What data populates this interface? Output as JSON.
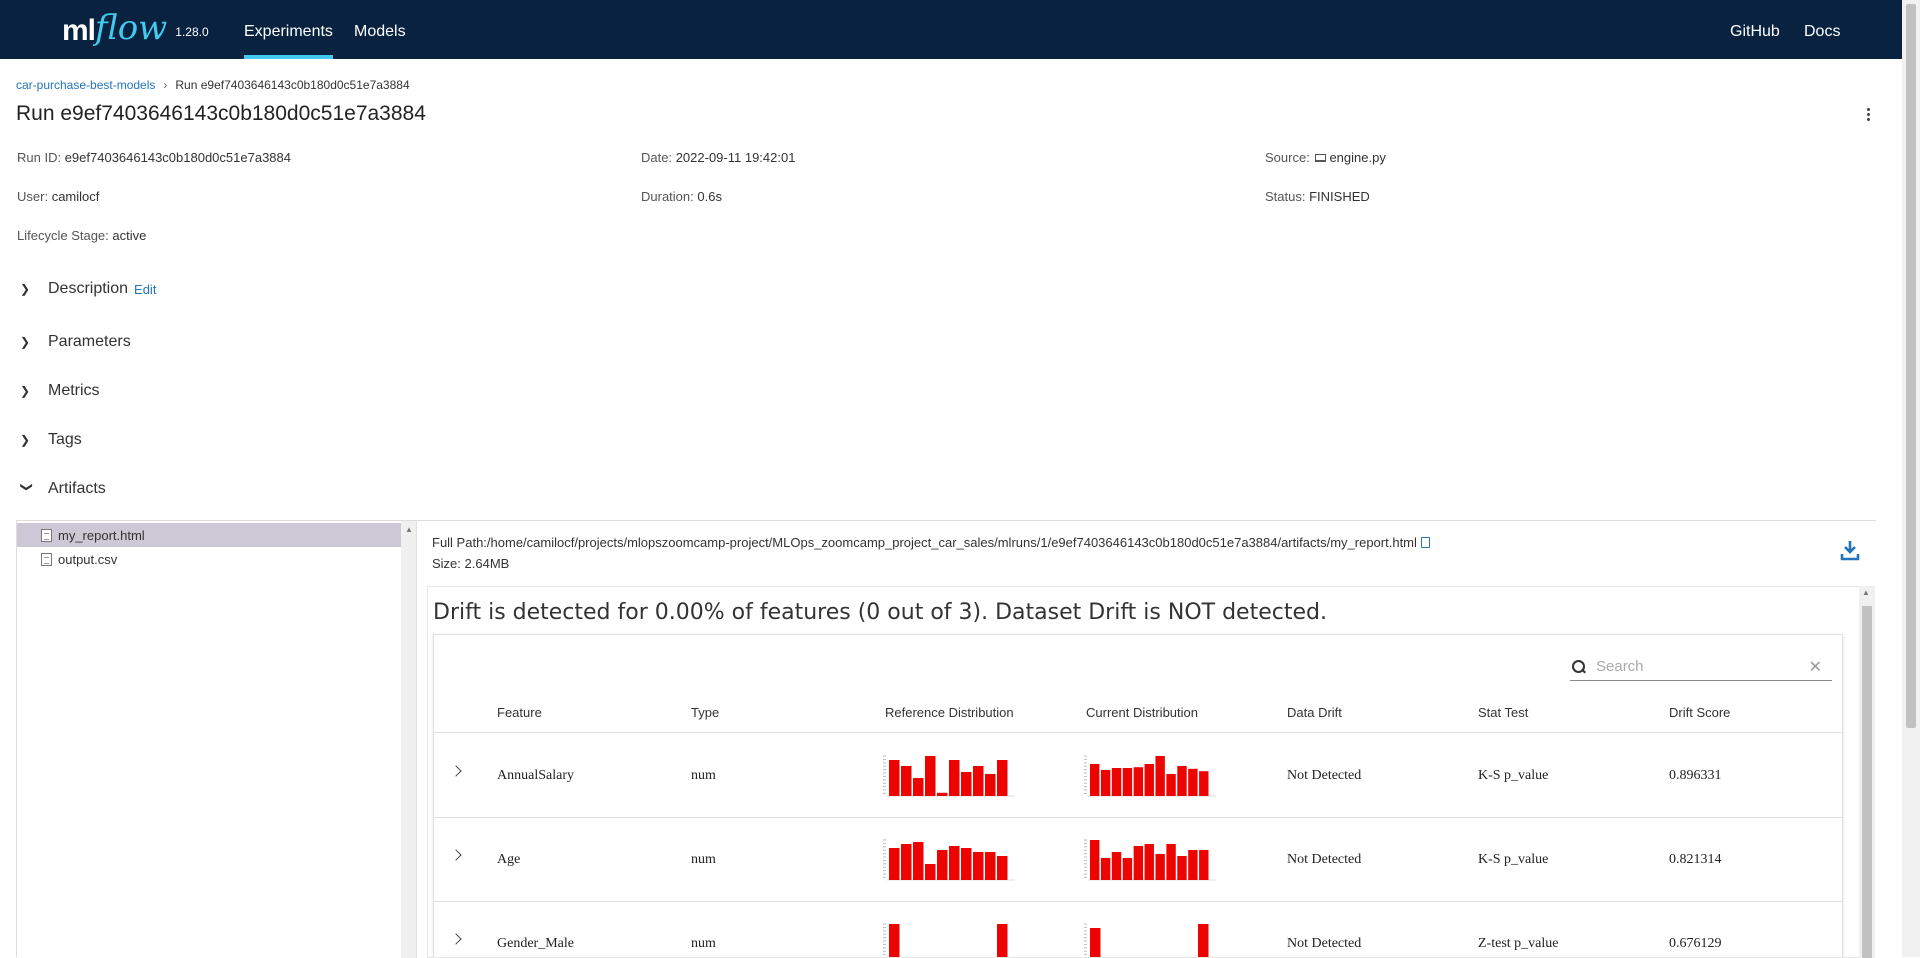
{
  "nav": {
    "logo_ml": "ml",
    "logo_flow": "flow",
    "version": "1.28.0",
    "links": [
      "Experiments",
      "Models"
    ],
    "right_links": [
      "GitHub",
      "Docs"
    ]
  },
  "breadcrumb": {
    "experiment": "car-purchase-best-models",
    "separator": "›",
    "current": "Run e9ef7403646143c0b180d0c51e7a3884"
  },
  "title": "Run e9ef7403646143c0b180d0c51e7a3884",
  "meta": {
    "run_id_label": "Run ID:",
    "run_id": "e9ef7403646143c0b180d0c51e7a3884",
    "date_label": "Date:",
    "date": "2022-09-11 19:42:01",
    "source_label": "Source:",
    "source": "engine.py",
    "user_label": "User:",
    "user": "camilocf",
    "duration_label": "Duration:",
    "duration": "0.6s",
    "status_label": "Status:",
    "status": "FINISHED",
    "lifecycle_label": "Lifecycle Stage:",
    "lifecycle": "active"
  },
  "sections": {
    "description": "Description",
    "edit": "Edit",
    "parameters": "Parameters",
    "metrics": "Metrics",
    "tags": "Tags",
    "artifacts": "Artifacts"
  },
  "files": [
    "my_report.html",
    "output.csv"
  ],
  "artifact": {
    "full_path": "Full Path:/home/camilocf/projects/mlopszoomcamp-project/MLOps_zoomcamp_project_car_sales/mlruns/1/e9ef7403646143c0b180d0c51e7a3884/artifacts/my_report.html",
    "size": "Size: 2.64MB"
  },
  "report": {
    "heading": "Drift is detected for 0.00% of features (0 out of 3). Dataset Drift is NOT detected.",
    "search_placeholder": "Search",
    "columns": [
      "Feature",
      "Type",
      "Reference Distribution",
      "Current Distribution",
      "Data Drift",
      "Stat Test",
      "Drift Score"
    ],
    "bar_color": "#ed0400",
    "rows": [
      {
        "feature": "AnnualSalary",
        "type": "num",
        "data_drift": "Not Detected",
        "stat_test": "K-S p_value",
        "drift_score": "0.896331",
        "ref_hist": [
          0.9,
          0.75,
          0.45,
          1.0,
          0.08,
          0.9,
          0.6,
          0.75,
          0.55,
          0.9
        ],
        "cur_hist": [
          0.8,
          0.65,
          0.7,
          0.7,
          0.72,
          0.8,
          1.0,
          0.55,
          0.75,
          0.68,
          0.62
        ]
      },
      {
        "feature": "Age",
        "type": "num",
        "data_drift": "Not Detected",
        "stat_test": "K-S p_value",
        "drift_score": "0.821314",
        "ref_hist": [
          0.8,
          0.9,
          0.95,
          0.4,
          0.75,
          0.85,
          0.8,
          0.7,
          0.7,
          0.6
        ],
        "cur_hist": [
          1.0,
          0.55,
          0.7,
          0.55,
          0.85,
          0.9,
          0.65,
          0.9,
          0.6,
          0.75,
          0.75
        ]
      },
      {
        "feature": "Gender_Male",
        "type": "num",
        "data_drift": "Not Detected",
        "stat_test": "Z-test p_value",
        "drift_score": "0.676129",
        "ref_hist": [
          1.0,
          0,
          0,
          0,
          0,
          0,
          0,
          0,
          0,
          1.0
        ],
        "cur_hist": [
          0.9,
          0,
          0,
          0,
          0,
          0,
          0,
          0,
          0,
          1.0
        ]
      }
    ]
  }
}
